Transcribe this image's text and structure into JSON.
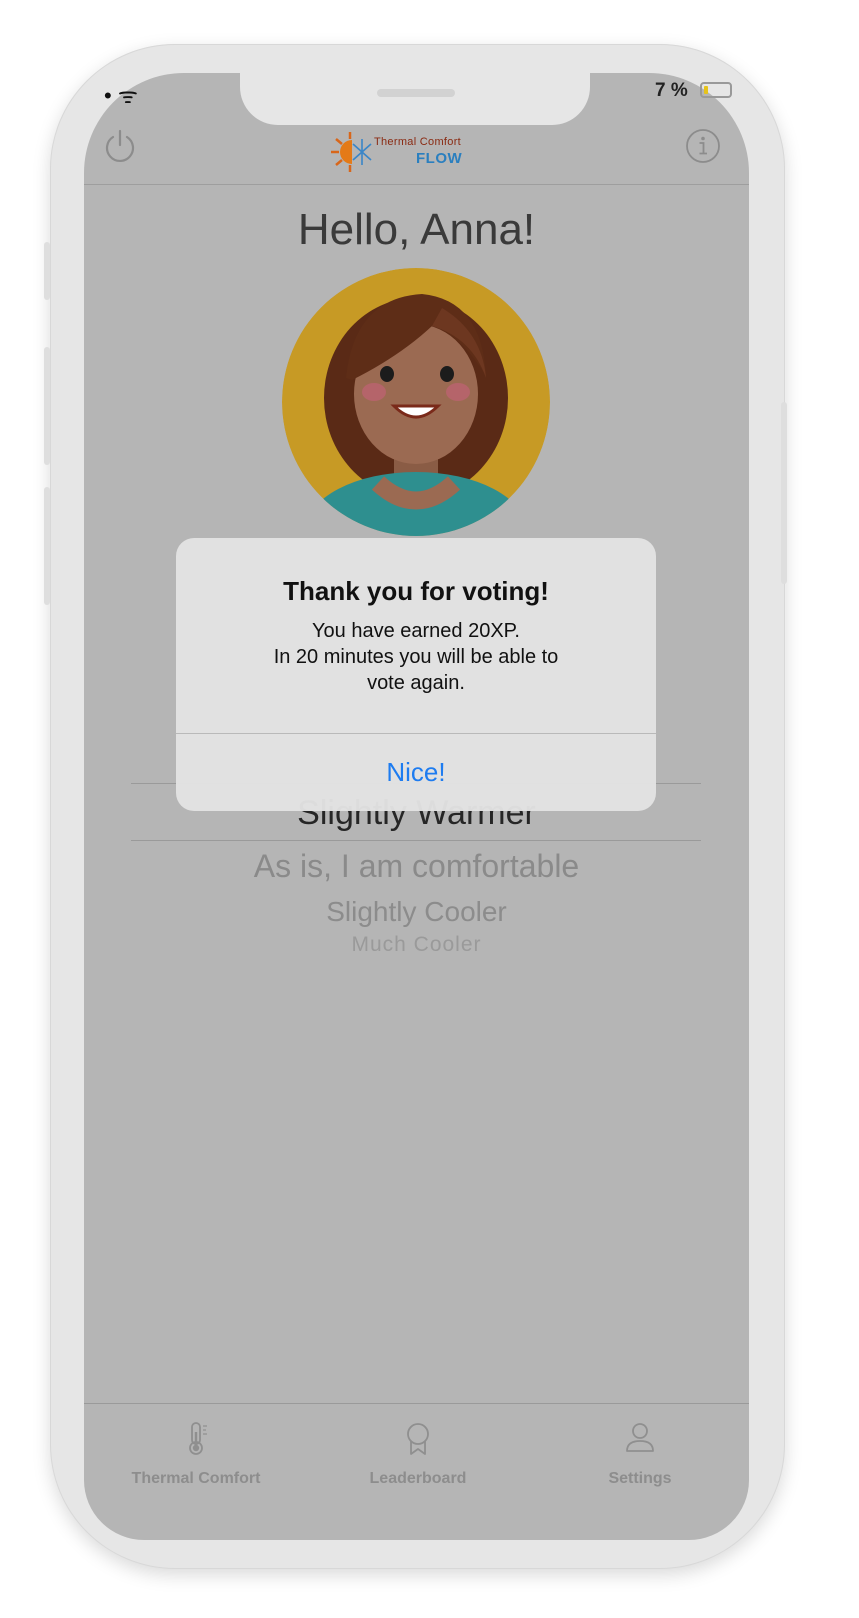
{
  "status_bar": {
    "signal": "• ᯤ",
    "battery_text": "7 %"
  },
  "header": {
    "logo_line1": "Thermal Comfort",
    "logo_line2": "FLOW"
  },
  "greeting": "Hello, Anna!",
  "picker": {
    "selected": "Slightly Warmer",
    "options": [
      "As is, I am comfortable",
      "Slightly Cooler",
      "Much Cooler"
    ]
  },
  "alert": {
    "title": "Thank you for voting!",
    "message": "You have earned 20XP.\nIn 20 minutes you will be able to\nvote again.",
    "button": "Nice!"
  },
  "tabs": [
    {
      "label": "Thermal Comfort",
      "icon": "thermometer-icon"
    },
    {
      "label": "Leaderboard",
      "icon": "award-icon"
    },
    {
      "label": "Settings",
      "icon": "person-icon"
    }
  ],
  "colors": {
    "accent": "#1e7cf0",
    "avatar_bg": "#c79a25",
    "overlay": "#b5b5b5"
  }
}
